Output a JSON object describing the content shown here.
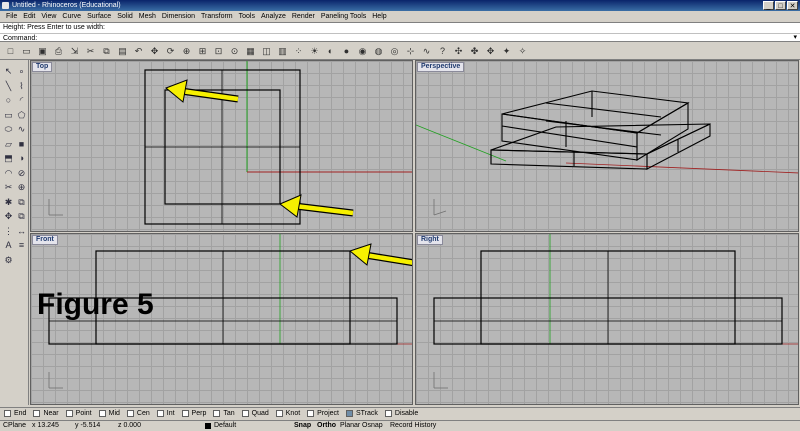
{
  "window": {
    "title": "Untitled - Rhinoceros (Educational)",
    "buttons": [
      "_",
      "□",
      "✕"
    ]
  },
  "menu": [
    "File",
    "Edit",
    "View",
    "Curve",
    "Surface",
    "Solid",
    "Mesh",
    "Dimension",
    "Transform",
    "Tools",
    "Analyze",
    "Render",
    "Paneling Tools",
    "Help"
  ],
  "command": {
    "history": "Height: Press Enter to use width:",
    "prompt": "Command:",
    "options_label": "▾"
  },
  "toolbar_icons": [
    "new-file",
    "open-file",
    "save-file",
    "print",
    "import",
    "cut",
    "copy",
    "paste",
    "undo",
    "pan",
    "rotate-view",
    "zoom-dynamic",
    "zoom-window",
    "zoom-extents",
    "zoom-selected",
    "four-viewports",
    "cplane",
    "grid",
    "select-points",
    "lights",
    "render-preview",
    "shade",
    "render",
    "material",
    "env-map",
    "point-on",
    "curve-tools",
    "help",
    "move",
    "copy-obj",
    "rotate",
    "scale",
    "mirror"
  ],
  "sidebar_icons": [
    "select",
    "point",
    "line",
    "polyline",
    "circle",
    "arc",
    "rectangle",
    "polygon",
    "ellipse",
    "freeform",
    "surface",
    "solid-box",
    "extrude",
    "boolean",
    "fillet",
    "split",
    "trim",
    "join",
    "explode",
    "group",
    "move",
    "copy",
    "array",
    "dimension",
    "text",
    "layer",
    "properties"
  ],
  "viewports": [
    {
      "label": "Top"
    },
    {
      "label": "Perspective"
    },
    {
      "label": "Front"
    },
    {
      "label": "Right"
    }
  ],
  "figure_label": "Figure 5",
  "osnaps": [
    {
      "label": "End",
      "checked": false
    },
    {
      "label": "Near",
      "checked": false
    },
    {
      "label": "Point",
      "checked": false
    },
    {
      "label": "Mid",
      "checked": false
    },
    {
      "label": "Cen",
      "checked": false
    },
    {
      "label": "Int",
      "checked": false
    },
    {
      "label": "Perp",
      "checked": false
    },
    {
      "label": "Tan",
      "checked": false
    },
    {
      "label": "Quad",
      "checked": false
    },
    {
      "label": "Knot",
      "checked": false
    },
    {
      "label": "Project",
      "checked": false
    },
    {
      "label": "STrack",
      "checked": true
    },
    {
      "label": "Disable",
      "checked": false
    }
  ],
  "status": {
    "cplane": "CPlane",
    "x": "x 13.245",
    "y": "y -5.514",
    "z": "z 0.000",
    "layer": "Default",
    "snap": "Snap",
    "ortho": "Ortho",
    "planar": "Planar",
    "osnap": "Osnap",
    "history": "Record History"
  },
  "colors": {
    "axis_red": "#a02020",
    "axis_green": "#20a020",
    "arrow": "#f6f000"
  }
}
